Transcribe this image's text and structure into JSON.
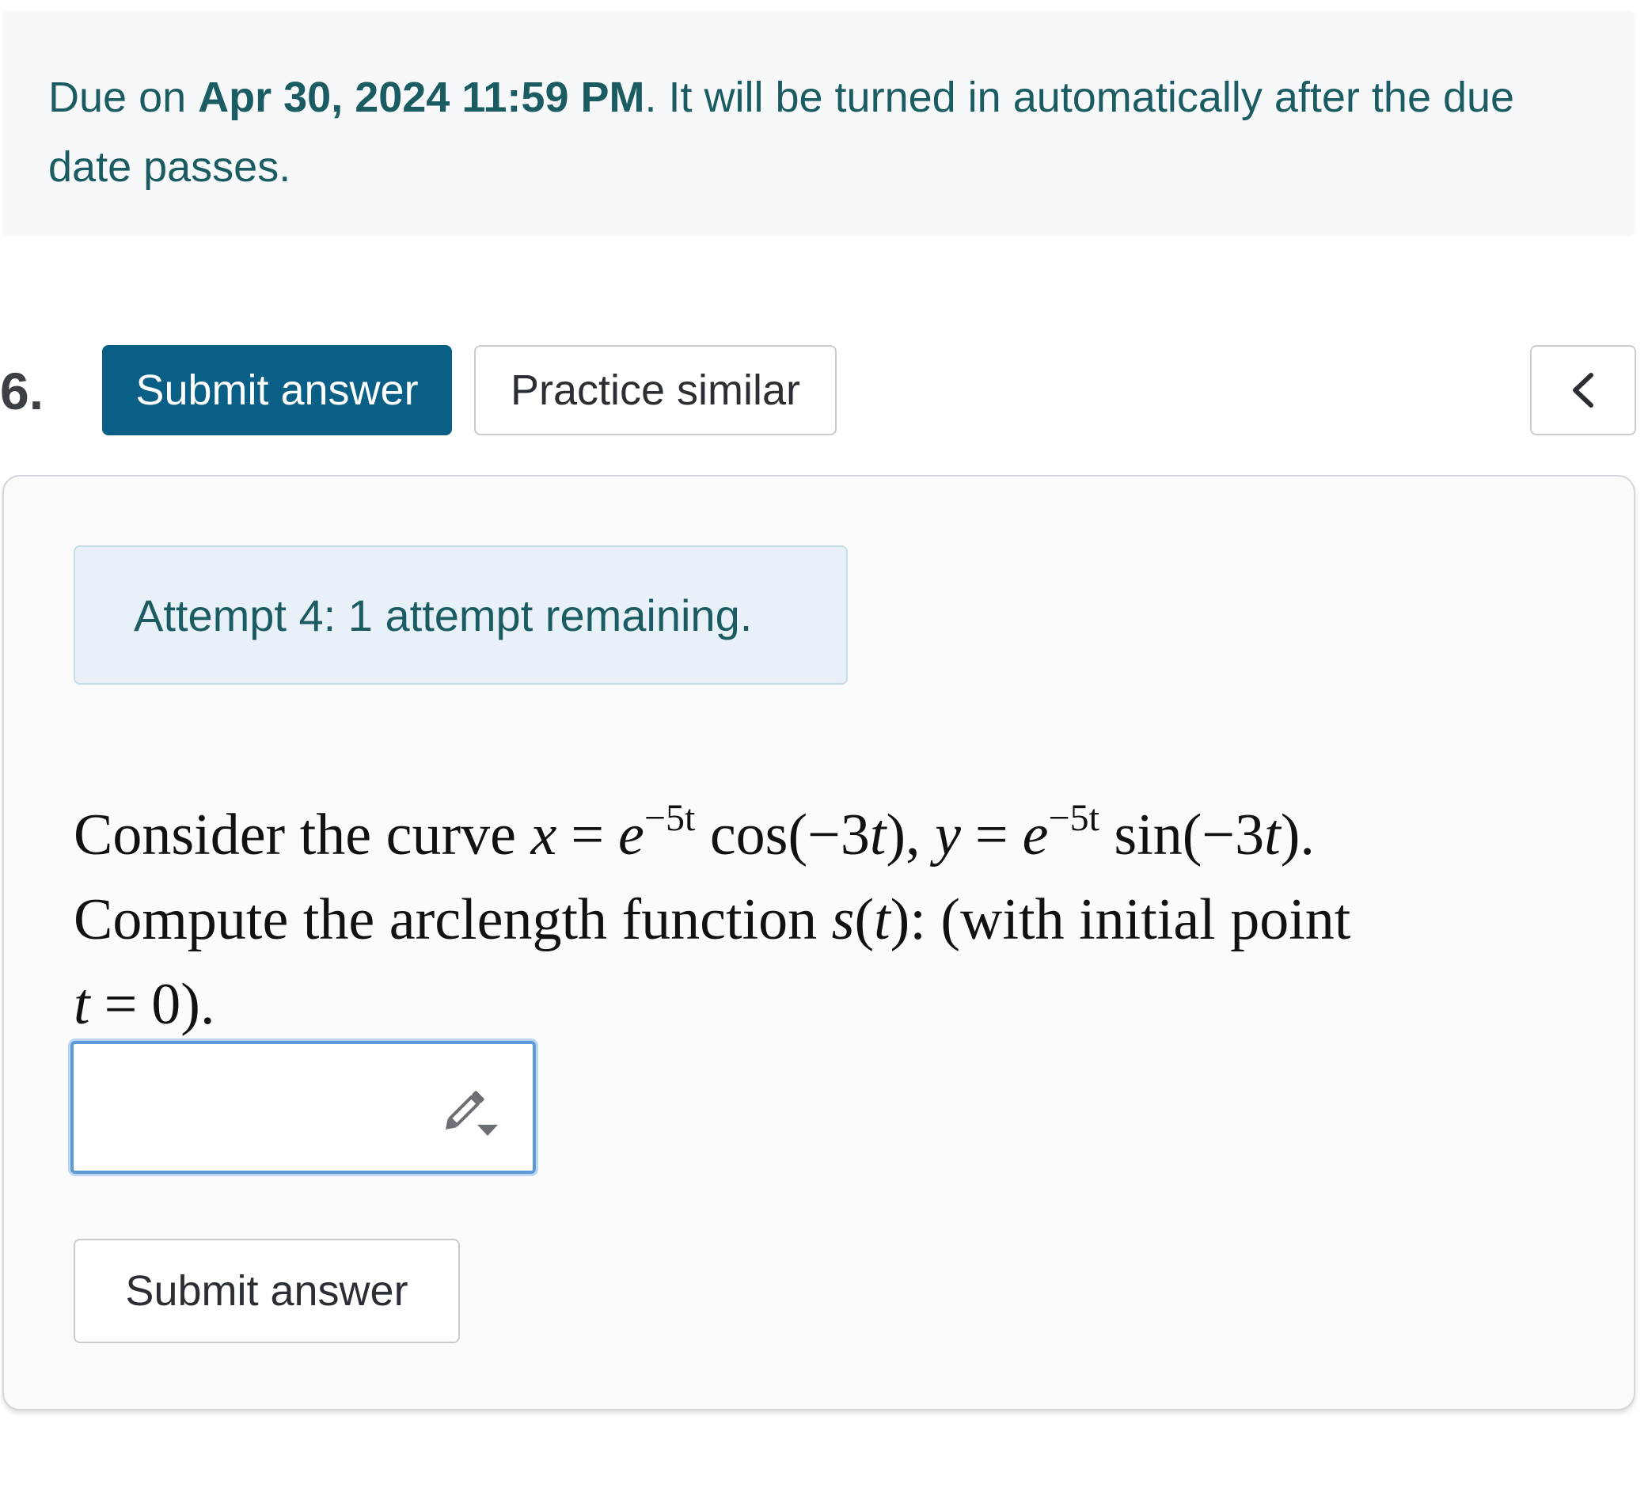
{
  "banner": {
    "prefix": "Due on ",
    "due_date": "Apr 30, 2024 11:59 PM",
    "suffix": ". It will be turned in automatically after the due date passes."
  },
  "question": {
    "number": "6.",
    "submit_label": "Submit answer",
    "practice_label": "Practice similar",
    "collapse_icon": "chevron-left-icon"
  },
  "card": {
    "attempt_text": "Attempt 4: 1 attempt remaining.",
    "problem": {
      "intro": "Consider the curve ",
      "x_var": "x",
      "eq": "=",
      "base": "e",
      "exponent": "−5t",
      "x_func": "cos(−3",
      "t": "t",
      "close_comma": "),",
      "y_var": "y",
      "y_func": "sin(−3",
      "close_period": ").",
      "line2": "Compute the arclength function ",
      "s": "s",
      "line2_tail": "): (with initial point",
      "zero": "0",
      "end": ")."
    },
    "answer_value": "",
    "pencil_icon": "pencil-dropdown-icon",
    "submit_bottom_label": "Submit answer"
  },
  "colors": {
    "primary_button": "#0a5f86",
    "banner_text": "#1b5c63",
    "input_focus": "#5b9ad6"
  }
}
